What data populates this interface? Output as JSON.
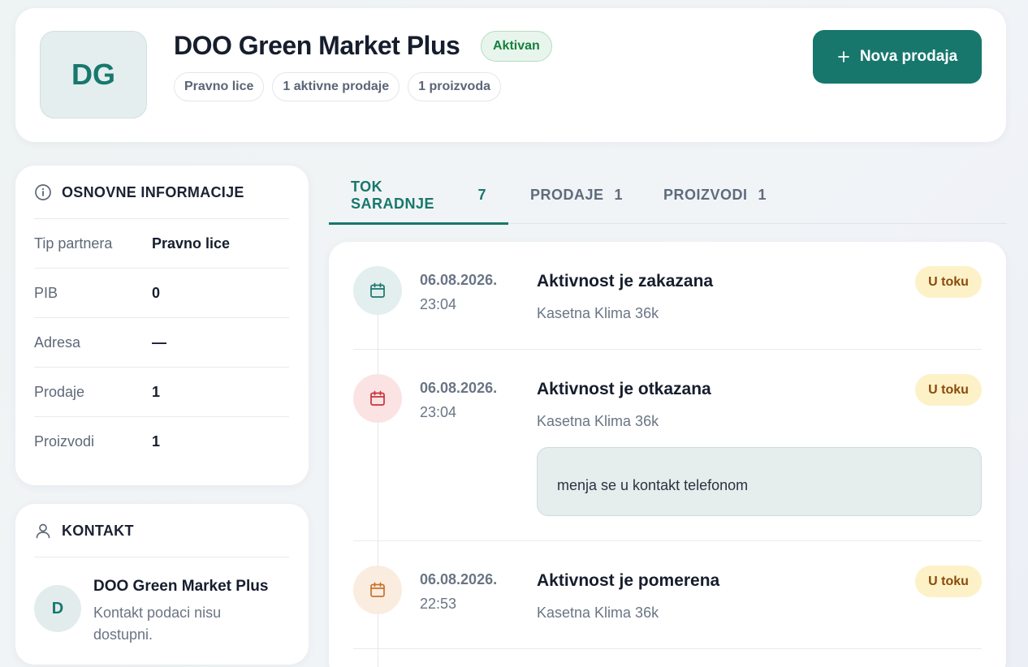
{
  "partner": {
    "initials": "DG",
    "name": "DOO Green Market Plus",
    "status": "Aktivan",
    "chips": [
      "Pravno lice",
      "1 aktivne prodaje",
      "1 proizvoda"
    ],
    "new_sale_label": "Nova prodaja"
  },
  "info": {
    "title": "OSNOVNE INFORMACIJE",
    "rows": [
      {
        "label": "Tip partnera",
        "value": "Pravno lice"
      },
      {
        "label": "PIB",
        "value": "0"
      },
      {
        "label": "Adresa",
        "value": "—"
      },
      {
        "label": "Prodaje",
        "value": "1"
      },
      {
        "label": "Proizvodi",
        "value": "1"
      }
    ]
  },
  "contact": {
    "title": "KONTAKT",
    "initial": "D",
    "name": "DOO Green Market Plus",
    "note": "Kontakt podaci nisu dostupni."
  },
  "tabs": [
    {
      "label": "TOK SARADNJE",
      "count": "7",
      "active": true
    },
    {
      "label": "PRODAJE",
      "count": "1",
      "active": false
    },
    {
      "label": "PROIZVODI",
      "count": "1",
      "active": false
    }
  ],
  "timeline": [
    {
      "date": "06.08.2026.",
      "time": "23:04",
      "title": "Aktivnost je zakazana",
      "product": "Kasetna Klima 36k",
      "status": "U toku",
      "icon": "calendar-icon",
      "icon_color": "#17786e",
      "icon_bg": "#e3eeee"
    },
    {
      "date": "06.08.2026.",
      "time": "23:04",
      "title": "Aktivnost je otkazana",
      "product": "Kasetna Klima 36k",
      "status": "U toku",
      "icon": "calendar-icon",
      "icon_color": "#c8323a",
      "icon_bg": "#fbe3e4",
      "note": "menja se u kontakt telefonom"
    },
    {
      "date": "06.08.2026.",
      "time": "22:53",
      "title": "Aktivnost je pomerena",
      "product": "Kasetna Klima 36k",
      "status": "U toku",
      "icon": "calendar-icon",
      "icon_color": "#c7742c",
      "icon_bg": "#fbece0"
    }
  ],
  "colors": {
    "accent": "#17776d",
    "badge_bg": "#fdf1c8",
    "badge_text": "#8a4b0b",
    "active_green": "#15803d"
  }
}
